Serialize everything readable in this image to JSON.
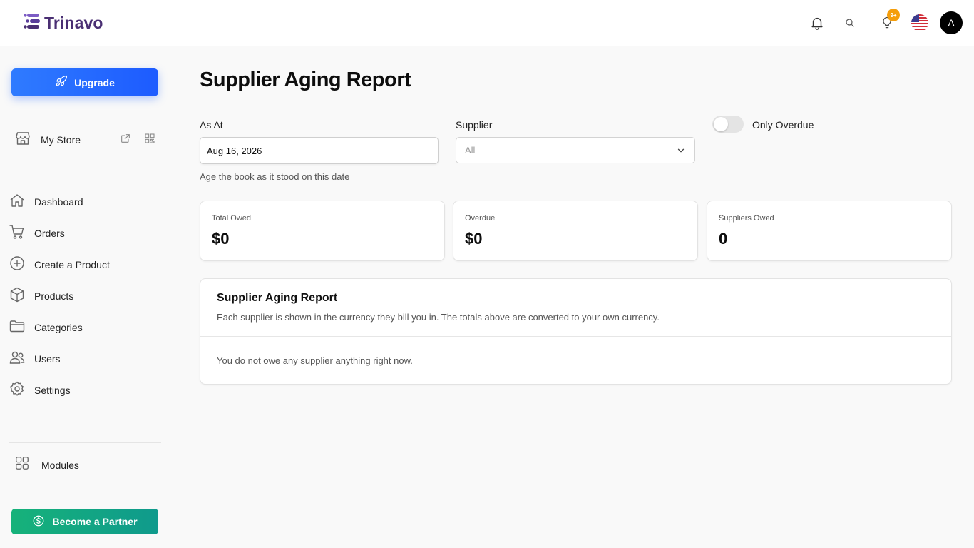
{
  "app": {
    "brand": "Trinavo"
  },
  "topbar": {
    "notifications_badge": "9+",
    "avatar_initial": "A",
    "icons": [
      "bell-icon",
      "search-icon",
      "lightbulb-icon",
      "us-flag-icon"
    ]
  },
  "sidebar": {
    "upgrade_label": "Upgrade",
    "store_label": "My Store",
    "items": [
      {
        "label": "Dashboard",
        "icon": "home-icon"
      },
      {
        "label": "Orders",
        "icon": "cart-icon"
      },
      {
        "label": "Create a Product",
        "icon": "plus-circle-icon"
      },
      {
        "label": "Products",
        "icon": "box-icon"
      },
      {
        "label": "Categories",
        "icon": "folder-icon"
      },
      {
        "label": "Users",
        "icon": "users-icon"
      },
      {
        "label": "Settings",
        "icon": "gear-icon"
      }
    ],
    "modules_label": "Modules",
    "partner_label": "Become a Partner"
  },
  "main": {
    "title": "Supplier Aging Report",
    "as_at_label": "As At",
    "as_at_value": "Aug 16, 2026",
    "as_at_helper": "Age the book as it stood on this date",
    "supplier_label": "Supplier",
    "supplier_value": "All",
    "only_overdue_label": "Only Overdue",
    "only_overdue_on": false,
    "cards": [
      {
        "label": "Total Owed",
        "value": "$0"
      },
      {
        "label": "Overdue",
        "value": "$0"
      },
      {
        "label": "Suppliers Owed",
        "value": "0"
      }
    ],
    "report": {
      "title": "Supplier Aging Report",
      "subtitle": "Each supplier is shown in the currency they bill you in. The totals above are converted to your own currency.",
      "empty_message": "You do not owe any supplier anything right now."
    }
  },
  "colors": {
    "brand": "#4a2f73",
    "upgrade": "#2f7bff",
    "partner": "#16b27a",
    "badge": "#f59e0b"
  }
}
